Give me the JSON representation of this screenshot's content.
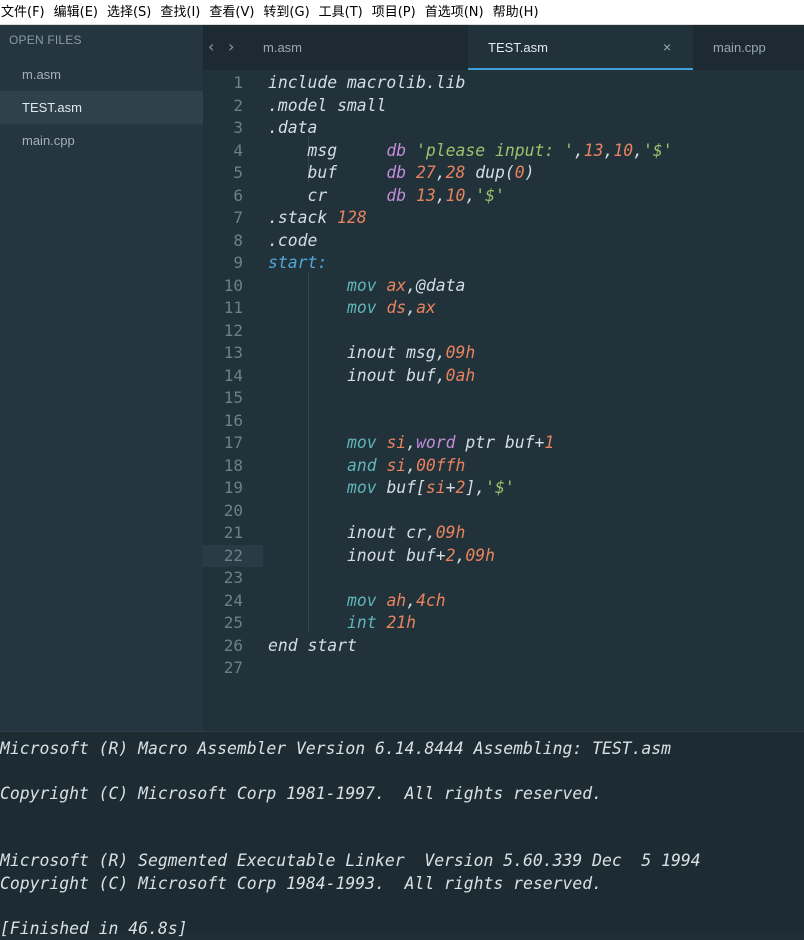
{
  "menu": [
    "文件(F)",
    "编辑(E)",
    "选择(S)",
    "查找(I)",
    "查看(V)",
    "转到(G)",
    "工具(T)",
    "项目(P)",
    "首选项(N)",
    "帮助(H)"
  ],
  "sidebar": {
    "header": "OPEN FILES",
    "files": [
      "m.asm",
      "TEST.asm",
      "main.cpp"
    ],
    "active_index": 1
  },
  "tabs": {
    "items": [
      "m.asm",
      "TEST.asm",
      "main.cpp"
    ],
    "active_index": 1,
    "close_glyph": "×",
    "back_glyph": "‹",
    "forward_glyph": "›"
  },
  "editor": {
    "current_line": 22,
    "lines": [
      {
        "n": "1",
        "tokens": [
          [
            "plain",
            "include macrolib.lib"
          ]
        ]
      },
      {
        "n": "2",
        "tokens": [
          [
            "plain",
            ".model small"
          ]
        ]
      },
      {
        "n": "3",
        "tokens": [
          [
            "plain",
            ".data"
          ]
        ]
      },
      {
        "n": "4",
        "tokens": [
          [
            "plain",
            "    msg     "
          ],
          [
            "dir",
            "db "
          ],
          [
            "str",
            "'please input: '"
          ],
          [
            "plain",
            ","
          ],
          [
            "num",
            "13"
          ],
          [
            "plain",
            ","
          ],
          [
            "num",
            "10"
          ],
          [
            "plain",
            ","
          ],
          [
            "str",
            "'$'"
          ]
        ]
      },
      {
        "n": "5",
        "tokens": [
          [
            "plain",
            "    buf     "
          ],
          [
            "dir",
            "db "
          ],
          [
            "num",
            "27"
          ],
          [
            "plain",
            ","
          ],
          [
            "num",
            "28"
          ],
          [
            "plain",
            " dup("
          ],
          [
            "num",
            "0"
          ],
          [
            "plain",
            ")"
          ]
        ]
      },
      {
        "n": "6",
        "tokens": [
          [
            "plain",
            "    cr      "
          ],
          [
            "dir",
            "db "
          ],
          [
            "num",
            "13"
          ],
          [
            "plain",
            ","
          ],
          [
            "num",
            "10"
          ],
          [
            "plain",
            ","
          ],
          [
            "str",
            "'$'"
          ]
        ]
      },
      {
        "n": "7",
        "tokens": [
          [
            "plain",
            ".stack "
          ],
          [
            "num",
            "128"
          ]
        ]
      },
      {
        "n": "8",
        "tokens": [
          [
            "plain",
            ".code"
          ]
        ]
      },
      {
        "n": "9",
        "tokens": [
          [
            "lbl",
            "start:"
          ]
        ]
      },
      {
        "n": "10",
        "tokens": [
          [
            "plain",
            "        "
          ],
          [
            "kw",
            "mov "
          ],
          [
            "reg",
            "ax"
          ],
          [
            "plain",
            ",@data"
          ]
        ]
      },
      {
        "n": "11",
        "tokens": [
          [
            "plain",
            "        "
          ],
          [
            "kw",
            "mov "
          ],
          [
            "reg",
            "ds"
          ],
          [
            "plain",
            ","
          ],
          [
            "reg",
            "ax"
          ]
        ]
      },
      {
        "n": "12",
        "tokens": []
      },
      {
        "n": "13",
        "tokens": [
          [
            "plain",
            "        inout msg,"
          ],
          [
            "num",
            "09h"
          ]
        ]
      },
      {
        "n": "14",
        "tokens": [
          [
            "plain",
            "        inout buf,"
          ],
          [
            "num",
            "0ah"
          ]
        ]
      },
      {
        "n": "15",
        "tokens": []
      },
      {
        "n": "16",
        "tokens": []
      },
      {
        "n": "17",
        "tokens": [
          [
            "plain",
            "        "
          ],
          [
            "kw",
            "mov "
          ],
          [
            "reg",
            "si"
          ],
          [
            "plain",
            ","
          ],
          [
            "dir",
            "word "
          ],
          [
            "plain",
            "ptr buf+"
          ],
          [
            "num",
            "1"
          ]
        ]
      },
      {
        "n": "18",
        "tokens": [
          [
            "plain",
            "        "
          ],
          [
            "kw",
            "and "
          ],
          [
            "reg",
            "si"
          ],
          [
            "plain",
            ","
          ],
          [
            "num",
            "00ffh"
          ]
        ]
      },
      {
        "n": "19",
        "tokens": [
          [
            "plain",
            "        "
          ],
          [
            "kw",
            "mov "
          ],
          [
            "plain",
            "buf["
          ],
          [
            "reg",
            "si"
          ],
          [
            "plain",
            "+"
          ],
          [
            "num",
            "2"
          ],
          [
            "plain",
            "],"
          ],
          [
            "str",
            "'$'"
          ]
        ]
      },
      {
        "n": "20",
        "tokens": []
      },
      {
        "n": "21",
        "tokens": [
          [
            "plain",
            "        inout cr,"
          ],
          [
            "num",
            "09h"
          ]
        ]
      },
      {
        "n": "22",
        "tokens": [
          [
            "plain",
            "        inout buf+"
          ],
          [
            "num",
            "2"
          ],
          [
            "plain",
            ","
          ],
          [
            "num",
            "09h"
          ]
        ]
      },
      {
        "n": "23",
        "tokens": []
      },
      {
        "n": "24",
        "tokens": [
          [
            "plain",
            "        "
          ],
          [
            "kw",
            "mov "
          ],
          [
            "reg",
            "ah"
          ],
          [
            "plain",
            ","
          ],
          [
            "num",
            "4ch"
          ]
        ]
      },
      {
        "n": "25",
        "tokens": [
          [
            "plain",
            "        "
          ],
          [
            "kw",
            "int "
          ],
          [
            "num",
            "21h"
          ]
        ]
      },
      {
        "n": "26",
        "tokens": [
          [
            "plain",
            "end start"
          ]
        ]
      },
      {
        "n": "27",
        "tokens": []
      }
    ]
  },
  "output": {
    "lines": [
      "Microsoft (R) Macro Assembler Version 6.14.8444 Assembling: TEST.asm",
      "",
      "Copyright (C) Microsoft Corp 1981-1997.  All rights reserved.",
      "",
      "",
      "Microsoft (R) Segmented Executable Linker  Version 5.60.339 Dec  5 1994",
      "Copyright (C) Microsoft Corp 1984-1993.  All rights reserved.",
      "",
      "[Finished in 46.8s]"
    ]
  },
  "colors": {
    "accent": "#3ea2d9",
    "keyword": "#5fb6b8",
    "number": "#e8835e",
    "string": "#9fc16b",
    "directive": "#c28cd8",
    "label": "#4ea7d8"
  }
}
